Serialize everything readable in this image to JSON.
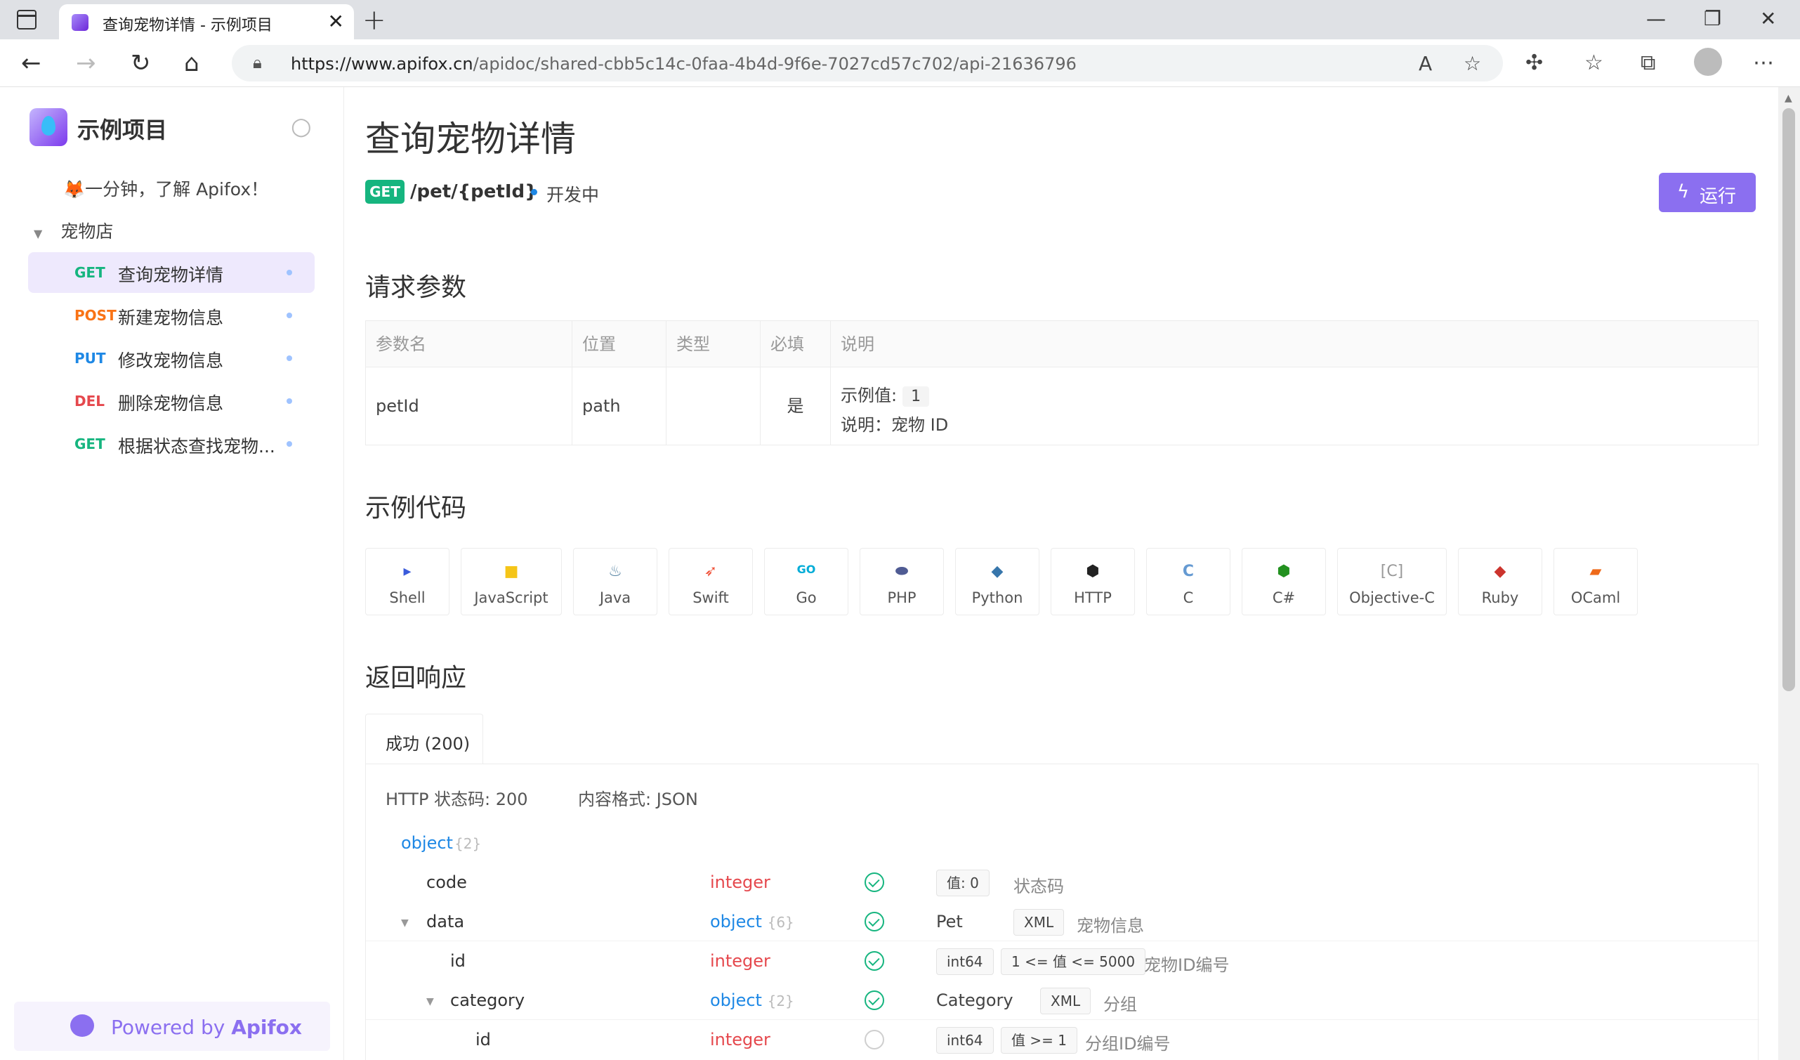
{
  "browser": {
    "tab_title": "查询宠物详情 - 示例项目",
    "url_host": "https://www.apifox.cn",
    "url_path": "/apidoc/shared-cbb5c14c-0faa-4b4d-9f6e-7027cd57c702/api-21636796"
  },
  "sidebar": {
    "project_name": "示例项目",
    "intro": "🦊一分钟，了解 Apifox！",
    "folder": "宠物店",
    "items": [
      {
        "method": "GET",
        "name": "查询宠物详情",
        "color": "#16b57f"
      },
      {
        "method": "POST",
        "name": "新建宠物信息",
        "color": "#f97316"
      },
      {
        "method": "PUT",
        "name": "修改宠物信息",
        "color": "#1e88e5"
      },
      {
        "method": "DEL",
        "name": "删除宠物信息",
        "color": "#e5484d"
      },
      {
        "method": "GET",
        "name": "根据状态查找宠物...",
        "color": "#16b57f"
      }
    ],
    "powered_prefix": "Powered by ",
    "powered_brand": "Apifox"
  },
  "main": {
    "title": "查询宠物详情",
    "method": "GET",
    "path": "/pet/{petId}",
    "status": "开发中",
    "run_label": "运行",
    "params_title": "请求参数",
    "param_headers": [
      "参数名",
      "位置",
      "类型",
      "必填",
      "说明"
    ],
    "param_row": {
      "name": "petId",
      "location": "path",
      "type": "",
      "required": "是",
      "example_label": "示例值:",
      "example_value": "1",
      "desc": "说明：宠物 ID"
    },
    "code_title": "示例代码",
    "languages": [
      "Shell",
      "JavaScript",
      "Java",
      "Swift",
      "Go",
      "PHP",
      "Python",
      "HTTP",
      "C",
      "C#",
      "Objective-C",
      "Ruby",
      "OCaml"
    ],
    "response_title": "返回响应",
    "response_tab": "成功 (200)",
    "http_status": "HTTP 状态码: 200",
    "content_type": "内容格式: JSON",
    "schema": {
      "root_type": "object",
      "root_count": "{2}",
      "rows": [
        {
          "name": "code",
          "type": "integer",
          "chip1": "值: 0",
          "desc": "状态码"
        },
        {
          "name": "data",
          "type": "object",
          "count": "{6}",
          "ref": "Pet",
          "chip1": "XML",
          "desc": "宠物信息"
        },
        {
          "name": "id",
          "type": "integer",
          "chip1": "int64",
          "chip2": "1 <= 值 <= 5000",
          "desc": "宠物ID编号"
        },
        {
          "name": "category",
          "type": "object",
          "count": "{2}",
          "ref": "Category",
          "chip1": "XML",
          "desc": "分组"
        },
        {
          "name": "id",
          "type": "integer",
          "chip1": "int64",
          "chip2": "值 >= 1",
          "desc": "分组ID编号"
        }
      ]
    }
  }
}
